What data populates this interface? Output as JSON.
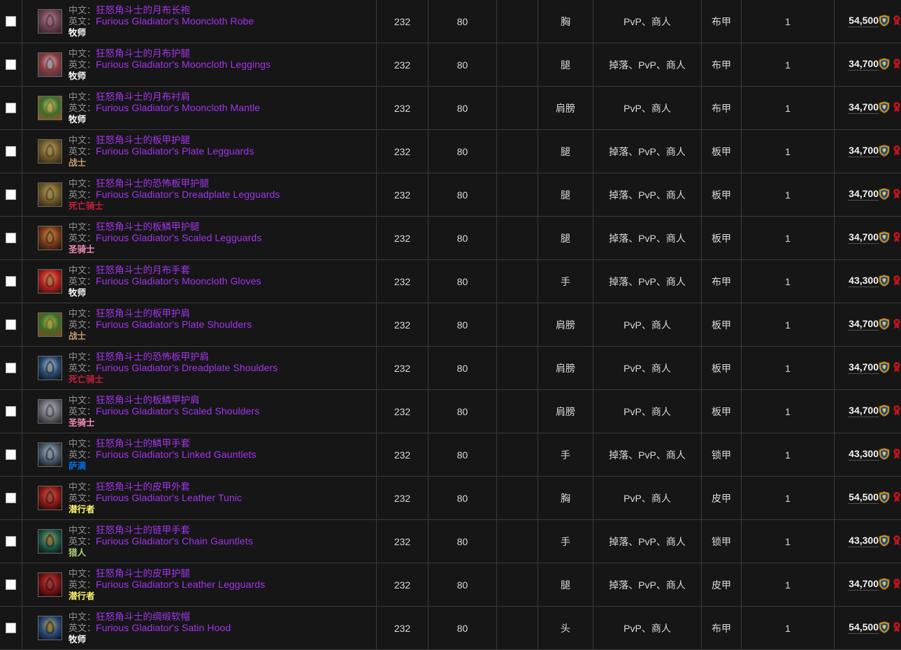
{
  "table": {
    "labels": {
      "cn": "中文：",
      "en": "英文："
    },
    "currency_icon": "honor-points-icon",
    "faction_icon": "horde-emblem-icon",
    "class_colors": {
      "牧师": "#FFFFFF",
      "战士": "#C79C6E",
      "死亡骑士": "#C41F3B",
      "圣骑士": "#F58CBA",
      "萨满": "#0070DE",
      "潜行者": "#FFF569",
      "猎人": "#ABD473"
    },
    "quality_color": "#a335ee",
    "rows": [
      {
        "cn_name": "狂怒角斗士的月布长袍",
        "en_name": "Furious Gladiator's Mooncloth Robe",
        "class": "牧师",
        "ilvl": "232",
        "level": "80",
        "extra": "",
        "slot": "胸",
        "source": "PvP、商人",
        "armor": "布甲",
        "count": "1",
        "price": "54,500",
        "icon_colors": [
          "#6b4352",
          "#3a2430",
          "#c08aa0"
        ]
      },
      {
        "cn_name": "狂怒角斗士的月布护腿",
        "en_name": "Furious Gladiator's Mooncloth Leggings",
        "class": "牧师",
        "ilvl": "232",
        "level": "80",
        "extra": "",
        "slot": "腿",
        "source": "掉落、PvP、商人",
        "armor": "布甲",
        "count": "1",
        "price": "34,700",
        "icon_colors": [
          "#8a3a3a",
          "#4a3344",
          "#d8c9d4"
        ]
      },
      {
        "cn_name": "狂怒角斗士的月布衬肩",
        "en_name": "Furious Gladiator's Mooncloth Mantle",
        "class": "牧师",
        "ilvl": "232",
        "level": "80",
        "extra": "",
        "slot": "肩膀",
        "source": "PvP、商人",
        "armor": "布甲",
        "count": "1",
        "price": "34,700",
        "icon_colors": [
          "#3e6b2a",
          "#8a5a2a",
          "#bcd66a"
        ]
      },
      {
        "cn_name": "狂怒角斗士的板甲护腿",
        "en_name": "Furious Gladiator's Plate Legguards",
        "class": "战士",
        "ilvl": "232",
        "level": "80",
        "extra": "",
        "slot": "腿",
        "source": "掉落、PvP、商人",
        "armor": "板甲",
        "count": "1",
        "price": "34,700",
        "icon_colors": [
          "#6f5a2a",
          "#3a2f18",
          "#c9b06a"
        ]
      },
      {
        "cn_name": "狂怒角斗士的恐怖板甲护腿",
        "en_name": "Furious Gladiator's Dreadplate Legguards",
        "class": "死亡骑士",
        "ilvl": "232",
        "level": "80",
        "extra": "",
        "slot": "腿",
        "source": "掉落、PvP、商人",
        "armor": "板甲",
        "count": "1",
        "price": "34,700",
        "icon_colors": [
          "#6f5a2a",
          "#3a2f18",
          "#c9b06a"
        ]
      },
      {
        "cn_name": "狂怒角斗士的板鳞甲护腿",
        "en_name": "Furious Gladiator's Scaled Legguards",
        "class": "圣骑士",
        "ilvl": "232",
        "level": "80",
        "extra": "",
        "slot": "腿",
        "source": "掉落、PvP、商人",
        "armor": "板甲",
        "count": "1",
        "price": "34,700",
        "icon_colors": [
          "#7a3a1a",
          "#2a1a10",
          "#d8a050"
        ]
      },
      {
        "cn_name": "狂怒角斗士的月布手套",
        "en_name": "Furious Gladiator's Mooncloth Gloves",
        "class": "牧师",
        "ilvl": "232",
        "level": "80",
        "extra": "",
        "slot": "手",
        "source": "掉落、PvP、商人",
        "armor": "布甲",
        "count": "1",
        "price": "43,300",
        "icon_colors": [
          "#b02020",
          "#40140e",
          "#e8a060"
        ]
      },
      {
        "cn_name": "狂怒角斗士的板甲护肩",
        "en_name": "Furious Gladiator's Plate Shoulders",
        "class": "战士",
        "ilvl": "232",
        "level": "80",
        "extra": "",
        "slot": "肩膀",
        "source": "PvP、商人",
        "armor": "板甲",
        "count": "1",
        "price": "34,700",
        "icon_colors": [
          "#3e6b2a",
          "#7a4a20",
          "#a8d050"
        ]
      },
      {
        "cn_name": "狂怒角斗士的恐怖板甲护肩",
        "en_name": "Furious Gladiator's Dreadplate Shoulders",
        "class": "死亡骑士",
        "ilvl": "232",
        "level": "80",
        "extra": "",
        "slot": "肩膀",
        "source": "PvP、商人",
        "armor": "板甲",
        "count": "1",
        "price": "34,700",
        "icon_colors": [
          "#2a4a70",
          "#101820",
          "#c8d4dc"
        ]
      },
      {
        "cn_name": "狂怒角斗士的板鳞甲护肩",
        "en_name": "Furious Gladiator's Scaled Shoulders",
        "class": "圣骑士",
        "ilvl": "232",
        "level": "80",
        "extra": "",
        "slot": "肩膀",
        "source": "PvP、商人",
        "armor": "板甲",
        "count": "1",
        "price": "34,700",
        "icon_colors": [
          "#6a6a72",
          "#2a2a30",
          "#c4c4cc"
        ]
      },
      {
        "cn_name": "狂怒角斗士的鳞甲手套",
        "en_name": "Furious Gladiator's Linked Gauntlets",
        "class": "萨满",
        "ilvl": "232",
        "level": "80",
        "extra": "",
        "slot": "手",
        "source": "掉落、PvP、商人",
        "armor": "锁甲",
        "count": "1",
        "price": "43,300",
        "icon_colors": [
          "#4a5a6a",
          "#161c22",
          "#bcc8d4"
        ]
      },
      {
        "cn_name": "狂怒角斗士的皮甲外套",
        "en_name": "Furious Gladiator's Leather Tunic",
        "class": "潜行者",
        "ilvl": "232",
        "level": "80",
        "extra": "",
        "slot": "胸",
        "source": "PvP、商人",
        "armor": "皮甲",
        "count": "1",
        "price": "54,500",
        "icon_colors": [
          "#8a1a1a",
          "#2a0a0a",
          "#d46a50"
        ]
      },
      {
        "cn_name": "狂怒角斗士的链甲手套",
        "en_name": "Furious Gladiator's Chain Gauntlets",
        "class": "猎人",
        "ilvl": "232",
        "level": "80",
        "extra": "",
        "slot": "手",
        "source": "掉落、PvP、商人",
        "armor": "锁甲",
        "count": "1",
        "price": "43,300",
        "icon_colors": [
          "#1e5a4a",
          "#0e1a18",
          "#c8a050"
        ]
      },
      {
        "cn_name": "狂怒角斗士的皮甲护腿",
        "en_name": "Furious Gladiator's Leather Legguards",
        "class": "潜行者",
        "ilvl": "232",
        "level": "80",
        "extra": "",
        "slot": "腿",
        "source": "掉落、PvP、商人",
        "armor": "皮甲",
        "count": "1",
        "price": "34,700",
        "icon_colors": [
          "#7a1414",
          "#240808",
          "#c85050"
        ]
      },
      {
        "cn_name": "狂怒角斗士的绸缎软帽",
        "en_name": "Furious Gladiator's Satin Hood",
        "class": "牧师",
        "ilvl": "232",
        "level": "80",
        "extra": "",
        "slot": "头",
        "source": "PvP、商人",
        "armor": "布甲",
        "count": "1",
        "price": "54,500",
        "icon_colors": [
          "#2a4a7a",
          "#0e1828",
          "#d8b040"
        ]
      }
    ]
  }
}
